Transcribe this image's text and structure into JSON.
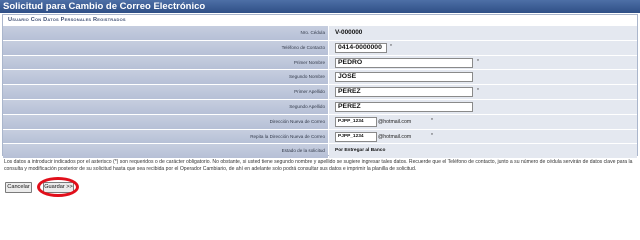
{
  "window": {
    "title": "Solicitud para Cambio de Correo Electrónico"
  },
  "section": {
    "title": "Usuario Con Datos Personales Registrados"
  },
  "fields": {
    "cedula": {
      "label": "Nro. Cédula",
      "value": "V-000000"
    },
    "telefono": {
      "label": "Teléfono de Contacto",
      "value": "0414-0000000",
      "required": "*"
    },
    "primer_nombre": {
      "label": "Primer Nombre",
      "value": "PEDRO",
      "required": "*"
    },
    "segundo_nombre": {
      "label": "Segundo Nombre",
      "value": "JOSÉ"
    },
    "primer_apellido": {
      "label": "Primer Apellido",
      "value": "PÉREZ",
      "required": "*"
    },
    "segundo_apellido": {
      "label": "Segundo Apellido",
      "value": "PÉREZ"
    },
    "correo_nuevo": {
      "label": "Dirección Nueva de Correo",
      "value": "PJPP_1234",
      "domain": "@hotmail.com",
      "required": "*"
    },
    "correo_repetir": {
      "label": "Repita la Dirección Nueva de Correo",
      "value": "PJPP_1234",
      "domain": "@hotmail.com",
      "required": "*"
    },
    "estado": {
      "label": "Estado de la solicitud",
      "value": "Por Entregar al Banco"
    }
  },
  "note": "Los datos a introducir indicados por el asterisco (*) son requeridos o de carácter obligatorio. No obstante, si usted tiene segundo nombre y apellido se sugiere ingresar tales datos. Recuerde que el Teléfono de contacto, junto a su número de cédula servirán de datos clave para la consulta y modificación posterior de su solicitud hasta que sea recibida por el Operador Cambiario, de ahí en adelante solo podrá consultar sus datos e imprimir la planilla de solicitud.",
  "buttons": {
    "cancel": "Cancelar",
    "save": "Guardar >>"
  },
  "colors": {
    "title_bar": "#2f4f86",
    "label_bg": "#bcc5d9",
    "highlight": "#e10f1b"
  }
}
